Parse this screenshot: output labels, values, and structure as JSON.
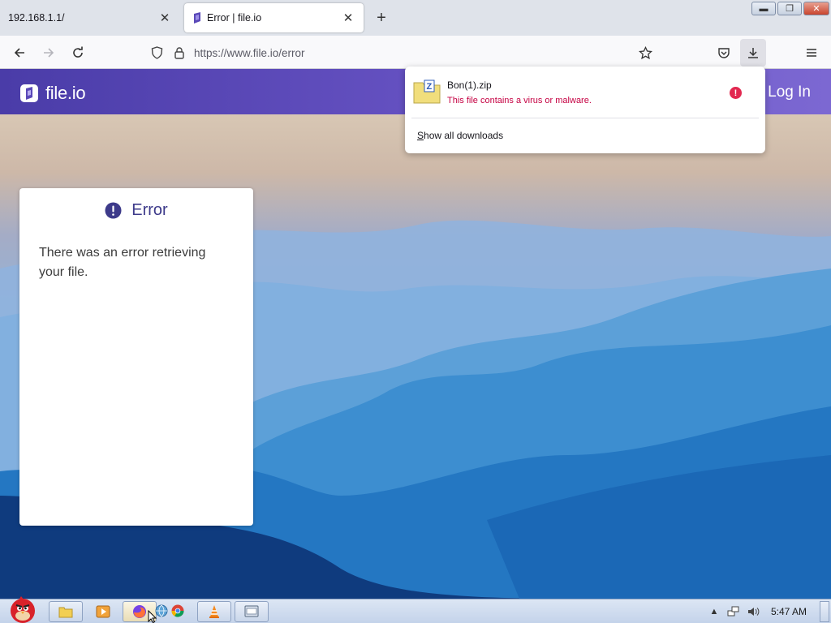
{
  "browser": {
    "tabs": [
      {
        "title": "192.168.1.1/",
        "active": false
      },
      {
        "title": "Error | file.io",
        "active": true
      }
    ],
    "new_tab_symbol": "+",
    "url": "https://www.file.io/error",
    "close_symbol": "✕"
  },
  "site": {
    "logo_text": "file.io",
    "login_label": "Log In"
  },
  "error_card": {
    "icon": "exclamation-circle-icon",
    "title": "Error",
    "message": "There was an error retrieving your file."
  },
  "downloads_panel": {
    "items": [
      {
        "filename": "Bon(1).zip",
        "status": "This file contains a virus or malware.",
        "icon": "zip-file-icon"
      }
    ],
    "show_all_label": "Show all downloads",
    "show_all_accesskey": "S",
    "show_all_rest": "how all downloads"
  },
  "taskbar": {
    "clock": "5:47 AM"
  },
  "colors": {
    "header_purple": "#5a48b8",
    "error_red": "#c50042",
    "card_title": "#3d3a8a"
  }
}
